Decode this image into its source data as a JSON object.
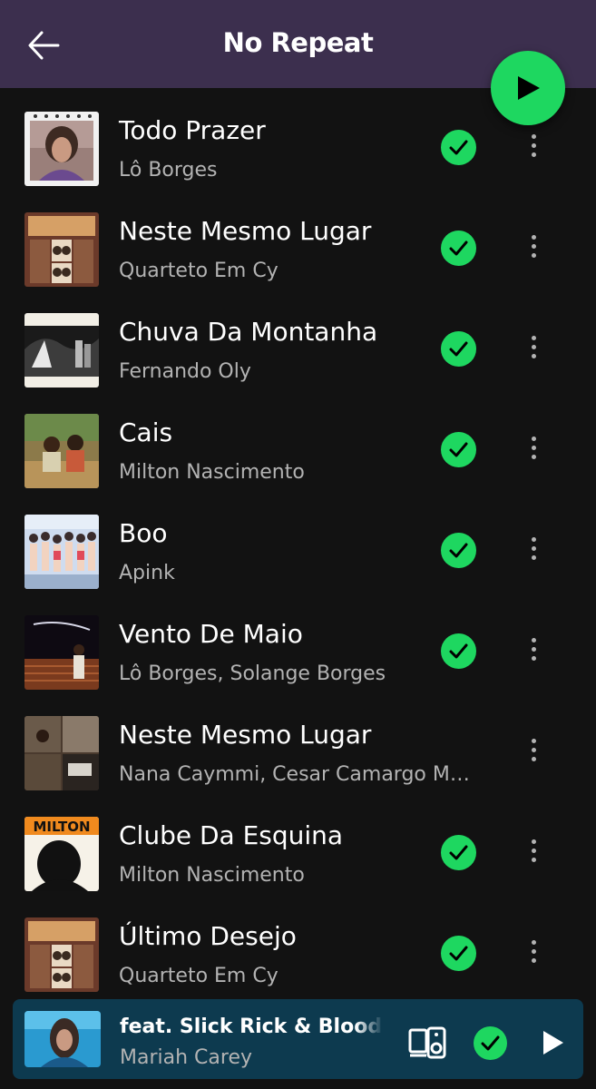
{
  "header": {
    "title": "No Repeat",
    "background": "#3c2f4e"
  },
  "accent_color": "#1ed760",
  "tracks": [
    {
      "title": "Todo Prazer",
      "artist": "Lô Borges",
      "liked": true
    },
    {
      "title": "Neste Mesmo Lugar",
      "artist": "Quarteto Em Cy",
      "liked": true
    },
    {
      "title": "Chuva Da Montanha",
      "artist": "Fernando Oly",
      "liked": true
    },
    {
      "title": "Cais",
      "artist": "Milton Nascimento",
      "liked": true
    },
    {
      "title": "Boo",
      "artist": "Apink",
      "liked": true
    },
    {
      "title": "Vento De Maio",
      "artist": "Lô Borges, Solange Borges",
      "liked": true
    },
    {
      "title": "Neste Mesmo Lugar",
      "artist": "Nana Caymmi, Cesar Camargo Mar...",
      "liked": false
    },
    {
      "title": "Clube Da Esquina",
      "artist": "Milton Nascimento",
      "liked": true
    },
    {
      "title": "Último Desejo",
      "artist": "Quarteto Em Cy",
      "liked": true
    }
  ],
  "album_art_text": {
    "milton_cover": "MILTON"
  },
  "now_playing": {
    "title": "feat. Slick Rick & Blood O",
    "artist": "Mariah Carey",
    "liked": true,
    "background": "#0d3a4f"
  },
  "icons": {
    "back": "arrow-left-icon",
    "play": "play-icon",
    "check": "checkmark-icon",
    "more": "more-vertical-icon",
    "device": "connect-device-icon"
  }
}
